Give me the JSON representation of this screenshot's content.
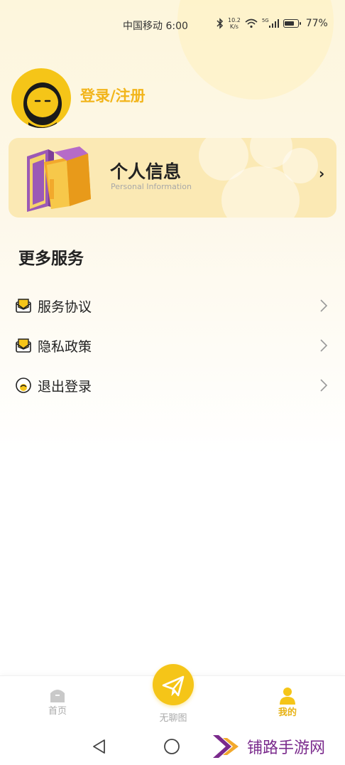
{
  "status_bar": {
    "carrier": "中国移动",
    "time": "6:00",
    "speed_top": "10.2",
    "speed_bottom": "K/s",
    "network": "5G",
    "battery": "77%"
  },
  "profile": {
    "login_label": "登录/注册"
  },
  "info_card": {
    "title": "个人信息",
    "subtitle": "Personal Information",
    "arrow": "›"
  },
  "more_services": {
    "title": "更多服务",
    "items": [
      {
        "label": "服务协议",
        "icon": "envelope-icon"
      },
      {
        "label": "隐私政策",
        "icon": "envelope-icon"
      },
      {
        "label": "退出登录",
        "icon": "logout-face-icon"
      }
    ]
  },
  "bottom_nav": {
    "items": [
      {
        "label": "首页",
        "icon": "home-icon",
        "active": false
      },
      {
        "label": "无聊图",
        "icon": "paper-plane-icon",
        "active": false
      },
      {
        "label": "我的",
        "icon": "person-icon",
        "active": true
      }
    ]
  },
  "watermark": {
    "text": "铺路手游网"
  },
  "colors": {
    "accent": "#f5c518",
    "login_text": "#f2b51b",
    "card_bg": "#fbe9b4",
    "watermark": "#7a2a8c"
  }
}
